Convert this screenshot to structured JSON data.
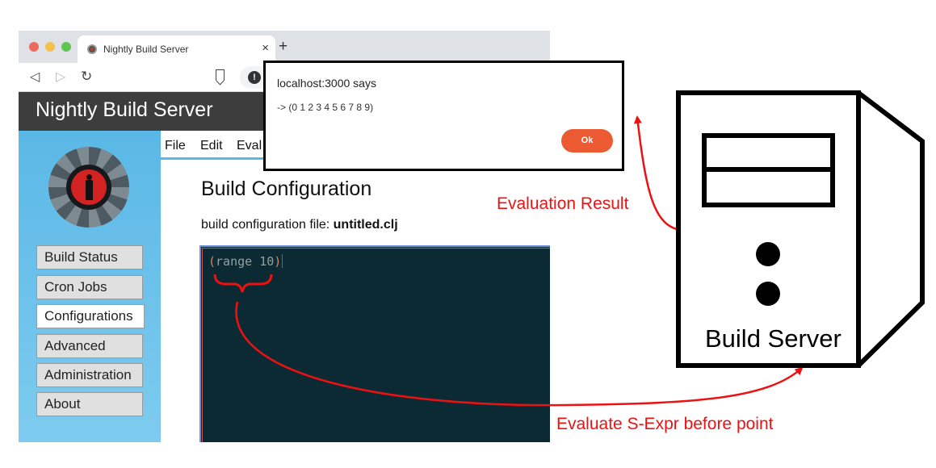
{
  "browser": {
    "tab_title": "Nightly Build Server",
    "tab_close_glyph": "×",
    "new_tab_glyph": "+",
    "toolbar": {
      "back_glyph": "◁",
      "forward_glyph": "▷",
      "reload_glyph": "↻",
      "info_glyph": "!"
    }
  },
  "site": {
    "title": "Nightly Build Server",
    "sidebar_items": [
      {
        "label": "Build Status"
      },
      {
        "label": "Cron Jobs"
      },
      {
        "label": "Configurations"
      },
      {
        "label": "Advanced"
      },
      {
        "label": "Administration"
      },
      {
        "label": "About"
      }
    ],
    "menubar": {
      "file": "File",
      "edit": "Edit",
      "eval": "Eval"
    },
    "heading": "Build Configuration",
    "config_label": "build configuration file: ",
    "config_file": "untitled.clj",
    "editor": {
      "open_paren": "(",
      "code": "range 10",
      "close_paren": ")"
    }
  },
  "dialog": {
    "title": "localhost:3000 says",
    "message": "-> (0 1 2 3 4 5 6 7 8 9)",
    "ok_label": "Ok"
  },
  "annotations": {
    "result_label": "Evaluation Result",
    "evaluate_label": "Evaluate S-Expr before point",
    "server_label": "Build Server",
    "color": "#ee1111"
  },
  "colors": {
    "header_bg": "#3d3d3d",
    "sidebar_bg": "#5ab8e6",
    "editor_bg": "#0b2a33",
    "ok_button": "#eb5a32"
  }
}
